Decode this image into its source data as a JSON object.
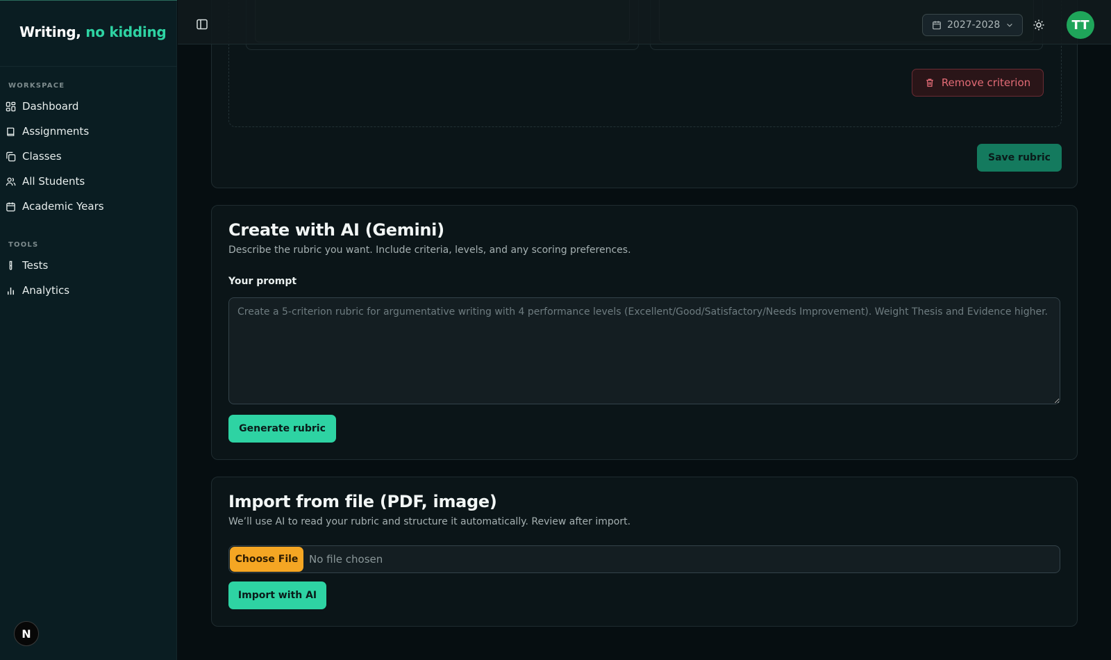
{
  "brand": {
    "name_main": "Writing,",
    "name_accent": "no kidding"
  },
  "sidebar": {
    "workspace_label": "WORKSPACE",
    "workspace_items": [
      {
        "label": "Dashboard",
        "icon": "dashboard-icon"
      },
      {
        "label": "Assignments",
        "icon": "book-icon"
      },
      {
        "label": "Classes",
        "icon": "classes-icon"
      },
      {
        "label": "All Students",
        "icon": "users-icon"
      },
      {
        "label": "Academic Years",
        "icon": "calendar-icon"
      }
    ],
    "tools_label": "TOOLS",
    "tools_items": [
      {
        "label": "Tests",
        "icon": "test-tube-icon"
      },
      {
        "label": "Analytics",
        "icon": "bar-chart-icon"
      }
    ],
    "footer_badge": "N"
  },
  "topbar": {
    "year_select": "2027-2028",
    "avatar_initials": "TT"
  },
  "rubric_editor": {
    "remove_criterion_label": "Remove criterion",
    "save_rubric_label": "Save rubric"
  },
  "ai_create": {
    "title": "Create with AI (Gemini)",
    "description": "Describe the rubric you want. Include criteria, levels, and any scoring preferences.",
    "prompt_label": "Your prompt",
    "prompt_placeholder": "Create a 5-criterion rubric for argumentative writing with 4 performance levels (Excellent/Good/Satisfactory/Needs Improvement). Weight Thesis and Evidence higher.",
    "prompt_value": "",
    "generate_label": "Generate rubric"
  },
  "import_file": {
    "title": "Import from file (PDF, image)",
    "description": "We’ll use AI to read your rubric and structure it automatically. Review after import.",
    "choose_file_label": "Choose File",
    "no_file_text": "No file chosen",
    "import_label": "Import with AI"
  },
  "colors": {
    "accent": "#2ed3a3",
    "background": "#060e11",
    "sidebar": "#0a1d22",
    "danger": "#e36b76",
    "file_button": "#f5a623",
    "avatar": "#1fa55a"
  }
}
